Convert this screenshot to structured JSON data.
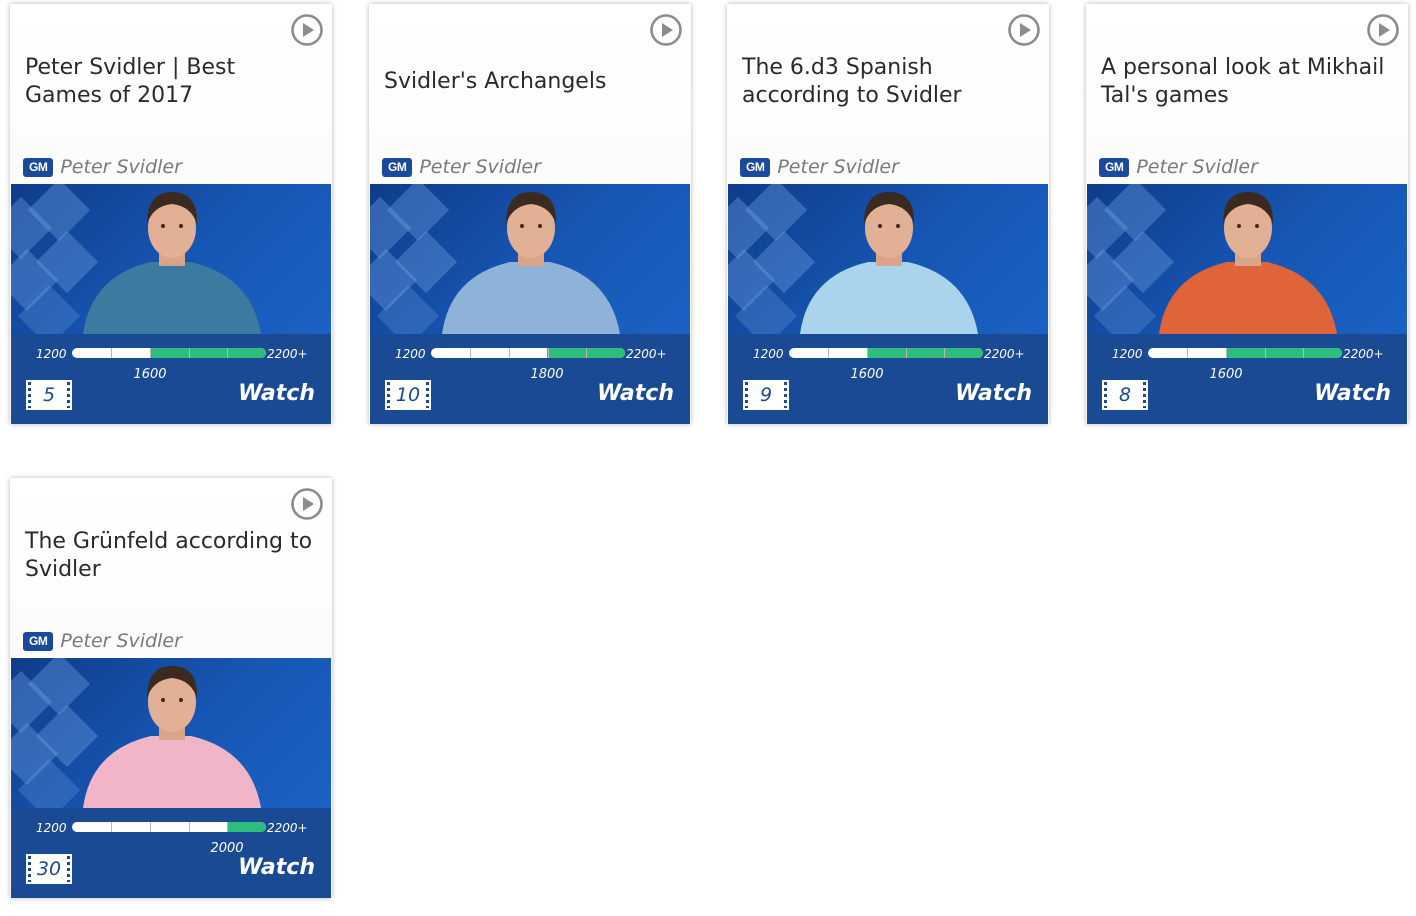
{
  "colors": {
    "brand_blue": "#1a4a93",
    "thumb_blue": "#1757b4",
    "level_green": "#2ebd7c",
    "title_text": "#2a2a2a",
    "author_text": "#7a7a7a"
  },
  "cards": [
    {
      "title": "Peter Svidler | Best Games of 2017",
      "badge": "GM",
      "author": "Peter Svidler",
      "level_min": "1200",
      "level_max": "2200+",
      "level": "1600",
      "level_value": 1600,
      "videos": "5",
      "watch": "Watch",
      "icon": "play-circle-icon",
      "shirt_color": "#3c7aa0"
    },
    {
      "title": "Svidler's Archangels",
      "badge": "GM",
      "author": "Peter Svidler",
      "level_min": "1200",
      "level_max": "2200+",
      "level": "1800",
      "level_value": 1800,
      "videos": "10",
      "watch": "Watch",
      "icon": "play-circle-icon",
      "shirt_color": "#8fb2d8"
    },
    {
      "title": "The 6.d3 Spanish according to Svidler",
      "badge": "GM",
      "author": "Peter Svidler",
      "level_min": "1200",
      "level_max": "2200+",
      "level": "1600",
      "level_value": 1600,
      "videos": "9",
      "watch": "Watch",
      "icon": "play-circle-icon",
      "shirt_color": "#a9d4ec"
    },
    {
      "title": "A personal look at Mikhail Tal's games",
      "badge": "GM",
      "author": "Peter Svidler",
      "level_min": "1200",
      "level_max": "2200+",
      "level": "1600",
      "level_value": 1600,
      "videos": "8",
      "watch": "Watch",
      "icon": "play-circle-icon",
      "shirt_color": "#e0643a"
    },
    {
      "title": "The Grünfeld according to Svidler",
      "badge": "GM",
      "author": "Peter Svidler",
      "level_min": "1200",
      "level_max": "2200+",
      "level": "2000",
      "level_value": 2000,
      "videos": "30",
      "watch": "Watch",
      "icon": "play-circle-icon",
      "shirt_color": "#f0b6c8"
    }
  ]
}
